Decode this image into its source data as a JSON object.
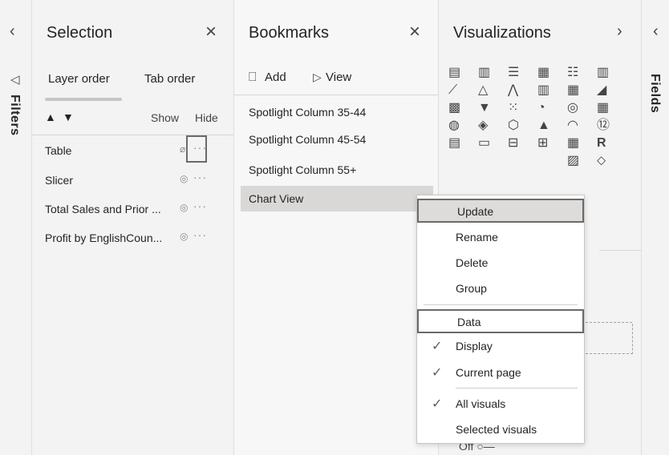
{
  "filters_rail": {
    "label": "Filters",
    "collapse": "‹",
    "icon": "◁"
  },
  "selection": {
    "title": "Selection",
    "close": "×",
    "tabs": [
      "Layer order",
      "Tab order"
    ],
    "up": "▲",
    "down": "▼",
    "show": "Show",
    "hide": "Hide",
    "layers": [
      {
        "label": "Table",
        "state": "hidden"
      },
      {
        "label": "Slicer",
        "state": "visible"
      },
      {
        "label": "Total Sales and Prior ...",
        "state": "visible"
      },
      {
        "label": "Profit by EnglishCoun...",
        "state": "visible"
      }
    ],
    "dots": "···",
    "eye_visible": "◎",
    "eye_hidden": "⌀"
  },
  "bookmarks": {
    "title": "Bookmarks",
    "close": "×",
    "add_icon": "⎕",
    "add": "Add",
    "view_icon": "▷",
    "view": "View",
    "items": [
      "Spotlight Column 35-44",
      "Spotlight Column 45-54",
      "Spotlight Column 55+",
      "Chart View"
    ]
  },
  "visualizations": {
    "title": "Visualizations",
    "expand": "›",
    "icons": [
      "▤",
      "▥",
      "☰",
      "▦",
      "☷",
      "▥",
      "⟋",
      "△",
      "⋀",
      "▥",
      "▦",
      "◢",
      "▩",
      "▼",
      "⁙",
      "◔",
      "◎",
      "▦",
      "◍",
      "◈",
      "⬡",
      "▲",
      "◠",
      "⑫",
      "▤",
      "▭",
      "⊟",
      "⊞",
      "▦",
      "R",
      "",
      "",
      "",
      "",
      "▨",
      "⬦"
    ]
  },
  "fields_rail": {
    "label": "Fields",
    "collapse": "‹"
  },
  "context_menu": {
    "items": [
      {
        "label": "Update",
        "check": ""
      },
      {
        "label": "Rename",
        "check": ""
      },
      {
        "label": "Delete",
        "check": ""
      },
      {
        "label": "Group",
        "check": ""
      },
      {
        "label": "Data",
        "check": ""
      },
      {
        "label": "Display",
        "check": "✓"
      },
      {
        "label": "Current page",
        "check": "✓"
      },
      {
        "label": "All visuals",
        "check": "✓"
      },
      {
        "label": "Selected visuals",
        "check": ""
      }
    ]
  },
  "toggle": {
    "label": "Off",
    "glyph": "○—"
  }
}
